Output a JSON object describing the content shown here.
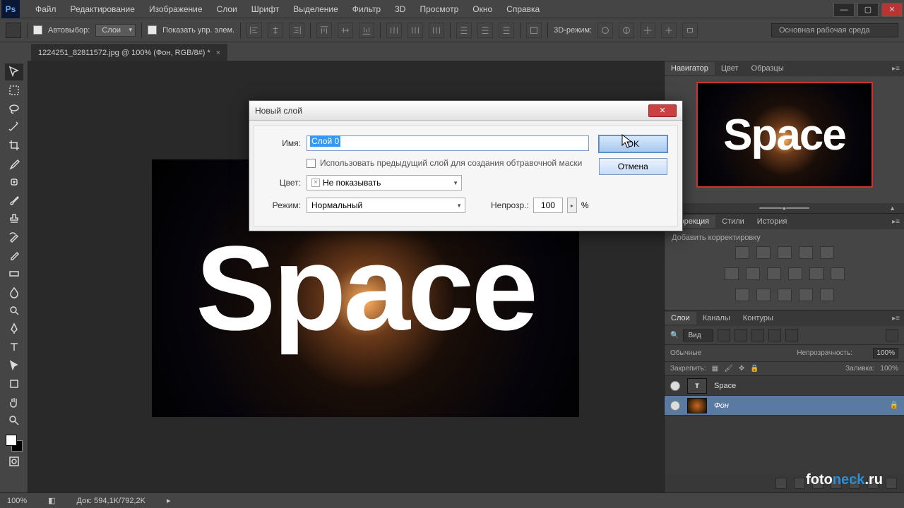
{
  "app": {
    "logo": "Ps"
  },
  "menu": [
    "Файл",
    "Редактирование",
    "Изображение",
    "Слои",
    "Шрифт",
    "Выделение",
    "Фильтр",
    "3D",
    "Просмотр",
    "Окно",
    "Справка"
  ],
  "optbar": {
    "auto_select": "Автовыбор:",
    "auto_select_dd": "Слои",
    "show_controls": "Показать упр. элем.",
    "mode_3d": "3D-режим:",
    "workspace": "Основная рабочая среда"
  },
  "document": {
    "tab_title": "1224251_82811572.jpg @ 100% (Фон, RGB/8#) *",
    "canvas_text": "Space"
  },
  "panels": {
    "nav_tabs": [
      "Навигатор",
      "Цвет",
      "Образцы"
    ],
    "adj_tabs": [
      "Коррекция",
      "Стили",
      "История"
    ],
    "adj_hint": "Добавить корректировку",
    "layer_tabs": [
      "Слои",
      "Каналы",
      "Контуры"
    ],
    "layer_filter": "Вид",
    "blend_mode": "Обычные",
    "opacity_label": "Непрозрачность:",
    "opacity_val": "100%",
    "lock_label": "Закрепить:",
    "fill_label": "Заливка:",
    "fill_val": "100%",
    "layers": [
      {
        "name": "Space",
        "type": "T",
        "selected": false,
        "locked": false
      },
      {
        "name": "Фон",
        "type": "img",
        "selected": true,
        "locked": true
      }
    ]
  },
  "status": {
    "zoom": "100%",
    "docsize": "Док: 594,1K/792,2K"
  },
  "watermark": {
    "a": "foto",
    "b": "neck",
    "c": ".ru"
  },
  "dialog": {
    "title": "Новый слой",
    "name_label": "Имя:",
    "name_value": "Слой 0",
    "clip_label": "Использовать предыдущий слой для создания обтравочной маски",
    "color_label": "Цвет:",
    "color_value": "Не показывать",
    "mode_label": "Режим:",
    "mode_value": "Нормальный",
    "opacity_label": "Непрозр.:",
    "opacity_value": "100",
    "opacity_pct": "%",
    "ok": "OK",
    "cancel": "Отмена"
  }
}
